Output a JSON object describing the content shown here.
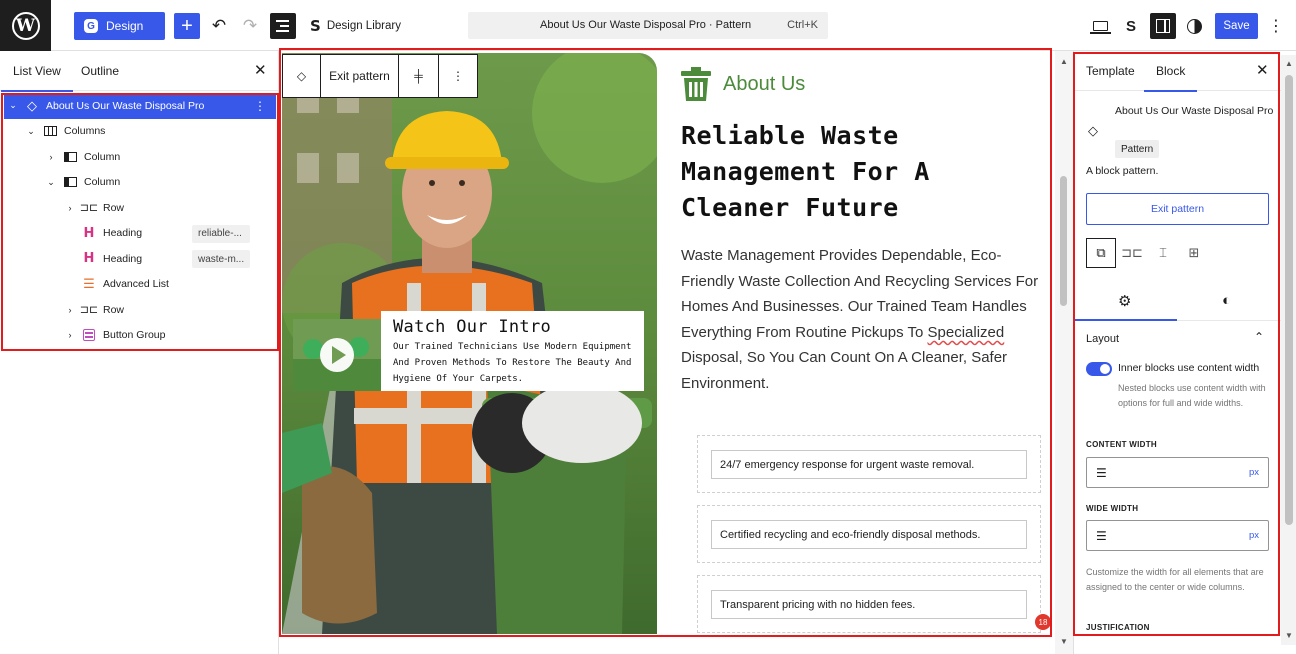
{
  "topbar": {
    "design_label": "Design",
    "design_library_label": "Design Library",
    "command_bar_title": "About Us Our Waste Disposal Pro · Pattern",
    "command_bar_shortcut": "Ctrl+K",
    "save_label": "Save"
  },
  "left_panel": {
    "tabs": [
      "List View",
      "Outline"
    ],
    "active_tab": "List View",
    "tree": [
      {
        "label": "About Us Our Waste Disposal Pro",
        "icon": "pattern-icon",
        "selected": true
      },
      {
        "label": "Columns",
        "icon": "columns-icon"
      },
      {
        "label": "Column",
        "icon": "column-icon"
      },
      {
        "label": "Column",
        "icon": "column-icon"
      },
      {
        "label": "Row",
        "icon": "row-icon"
      },
      {
        "label": "Heading",
        "icon": "heading-icon",
        "anchor": "reliable-..."
      },
      {
        "label": "Heading",
        "icon": "heading-icon",
        "anchor": "waste-m..."
      },
      {
        "label": "Advanced List",
        "icon": "list-icon"
      },
      {
        "label": "Row",
        "icon": "row-icon"
      },
      {
        "label": "Button Group",
        "icon": "button-group-icon"
      }
    ]
  },
  "canvas": {
    "toolbar": {
      "exit_label": "Exit pattern"
    },
    "video": {
      "title": "Watch Our Intro",
      "description": "Our Trained Technicians Use Modern Equipment And Proven Methods To Restore The Beauty And Hygiene Of Your Carpets."
    },
    "about_label": "About Us",
    "heading": "Reliable Waste Management For A Cleaner Future",
    "paragraph_before": "Waste Management Provides Dependable, Eco-Friendly Waste Collection And Recycling Services For Homes And Businesses. Our Trained Team Handles Everything From Routine Pickups To ",
    "paragraph_misspelled": "Specialized",
    "paragraph_after": " Disposal, So You Can Count On A Cleaner, Safer Environment.",
    "features": [
      "24/7 emergency response for urgent waste removal.",
      "Certified recycling and eco-friendly disposal methods.",
      "Transparent pricing with no hidden fees."
    ],
    "notification_count": "18",
    "accent_color": "#4b8b3b"
  },
  "right_panel": {
    "tabs": [
      "Template",
      "Block"
    ],
    "active_tab": "Block",
    "block_title": "About Us Our Waste Disposal Pro",
    "block_type": "Pattern",
    "block_description": "A block pattern.",
    "exit_label": "Exit pattern",
    "layout_title": "Layout",
    "toggle_label": "Inner blocks use content width",
    "toggle_on": true,
    "toggle_help": "Nested blocks use content width with options for full and wide widths.",
    "content_width_label": "CONTENT WIDTH",
    "content_width_unit": "px",
    "wide_width_label": "WIDE WIDTH",
    "wide_width_unit": "px",
    "width_help": "Customize the width for all elements that are assigned to the center or wide columns.",
    "justification_label": "JUSTIFICATION"
  },
  "colors": {
    "admin_blue": "#3858e9",
    "highlight_red": "#e21c1c",
    "dark": "#1e1e1e"
  }
}
